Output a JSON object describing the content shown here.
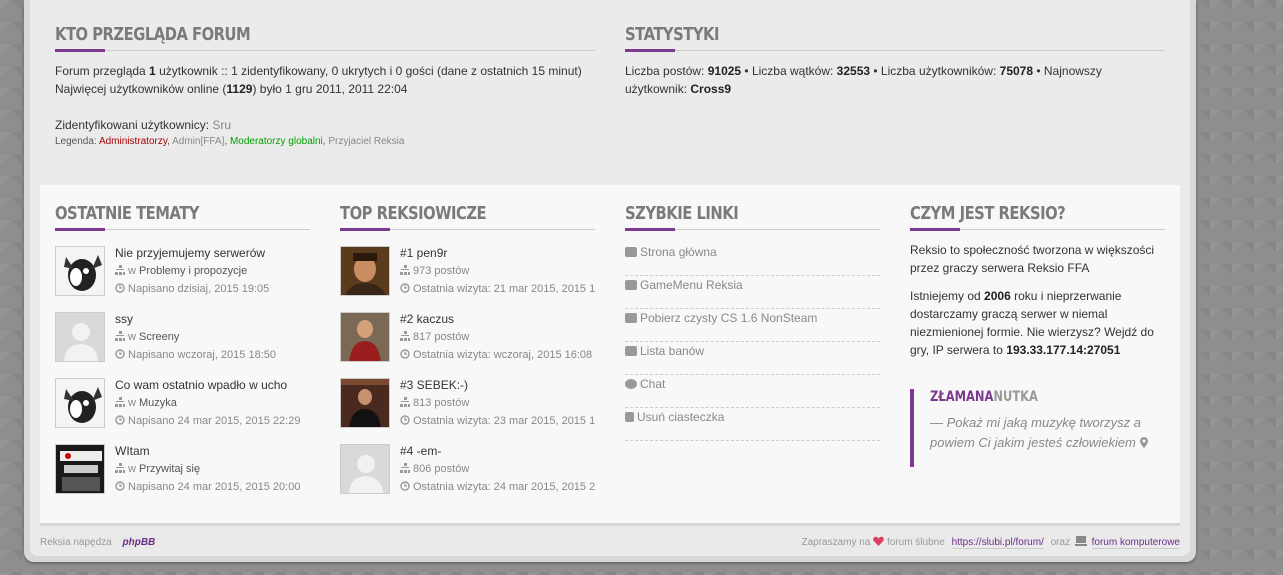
{
  "who": {
    "title": "KTO PRZEGLĄDA FORUM",
    "line1_pre": "Forum przegląda ",
    "line1_count": "1",
    "line1_post": " użytkownik :: 1 zidentyfikowany, 0 ukrytych i 0 gości (dane z ostatnich 15 minut)",
    "line2_pre": "Najwięcej użytkowników online (",
    "line2_count": "1129",
    "line2_post": ") było 1 gru 2011, 2011 22:04",
    "identified_label": "Zidentyfikowani użytkownicy: ",
    "identified_user": "Sru",
    "legend_label": "Legenda: ",
    "legend_admins": "Administratorzy",
    "legend_adminffa": "Admin[FFA]",
    "legend_mods": "Moderatorzy globalni",
    "legend_friends": "Przyjaciel Reksia"
  },
  "stats": {
    "title": "STATYSTYKI",
    "posts_label": "Liczba postów: ",
    "posts": "91025",
    "topics_label": " • Liczba wątków: ",
    "topics": "32553",
    "users_label": " • Liczba użytkowników: ",
    "users": "75078",
    "newest_label": " • Najnowszy użytkownik: ",
    "newest": "Cross9"
  },
  "recent": {
    "title": "OSTATNIE TEMATY",
    "items": [
      {
        "title": "Nie przyjemujemy serwerów",
        "in": "w ",
        "forum": "Problemy i propozycje",
        "date": "Napisano dzisiaj, 2015 19:05"
      },
      {
        "title": "ssy",
        "in": "w ",
        "forum": "Screeny",
        "date": "Napisano wczoraj, 2015 18:50"
      },
      {
        "title": "Co wam ostatnio wpadło w ucho",
        "in": "w ",
        "forum": "Muzyka",
        "date": "Napisano 24 mar 2015, 2015 22:29"
      },
      {
        "title": "WItam",
        "in": "w ",
        "forum": "Przywitaj się",
        "date": "Napisano 24 mar 2015, 2015 20:00"
      }
    ]
  },
  "top": {
    "title": "TOP REKSIOWICZE",
    "items": [
      {
        "name": "#1 pen9r",
        "posts": "973 postów",
        "visit": "Ostatnia wizyta: 21 mar 2015, 2015 1"
      },
      {
        "name": "#2 kaczus",
        "posts": "817 postów",
        "visit": "Ostatnia wizyta: wczoraj, 2015 16:08"
      },
      {
        "name": "#3 SEBEK:-)",
        "posts": "813 postów",
        "visit": "Ostatnia wizyta: 23 mar 2015, 2015 1"
      },
      {
        "name": "#4 -em-",
        "posts": "806 postów",
        "visit": "Ostatnia wizyta: 24 mar 2015, 2015 2"
      }
    ]
  },
  "quick": {
    "title": "SZYBKIE LINKI",
    "links": [
      {
        "label": "Strona główna",
        "icon": "home-icon"
      },
      {
        "label": "GameMenu Reksia",
        "icon": "image-icon"
      },
      {
        "label": "Pobierz czysty CS 1.6 NonSteam",
        "icon": "chart-icon"
      },
      {
        "label": "Lista banów",
        "icon": "users-icon"
      },
      {
        "label": "Chat",
        "icon": "chat-icon"
      },
      {
        "label": "Usuń ciasteczka",
        "icon": "trash-icon"
      }
    ]
  },
  "about": {
    "title": "CZYM JEST REKSIO?",
    "p1": "Reksio to społeczność tworzona w większości przez graczy serwera Reksio FFA",
    "p2_pre": "Istniejemy od ",
    "p2_year": "2006",
    "p2_mid": " roku i nieprzerwanie dostarczamy graczą serwer w niemal niezmienionej formie. Nie wierzysz? Wejdź do gry, IP serwera to ",
    "p2_ip": "193.33.177.14:27051",
    "quote_title_a": "ZŁAMANA",
    "quote_title_b": "NUTKA",
    "quote_text": "— Pokaż mi jaką muzykę tworzysz a powiem Ci jakim jesteś człowiekiem"
  },
  "footer": {
    "powered": "Reksia napędza",
    "phpbb": "phpBB",
    "invite": "Zapraszamy na",
    "wedding": "forum ślubne",
    "wedding_url": "https://slubi.pl/forum/",
    "and": "oraz",
    "computer": "forum komputerowe"
  }
}
